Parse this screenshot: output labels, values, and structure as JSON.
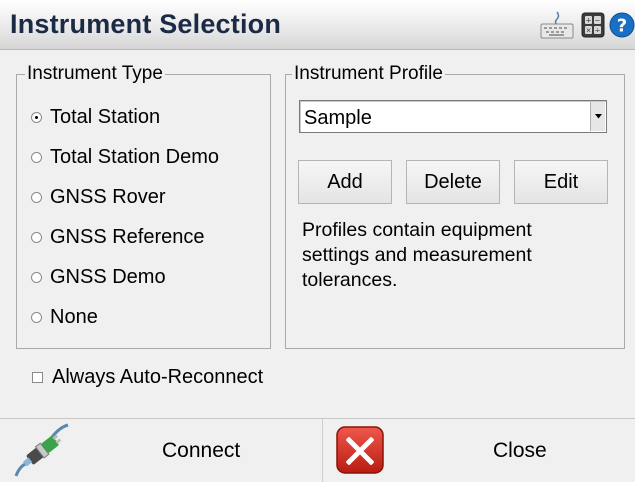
{
  "window": {
    "title": "Instrument Selection"
  },
  "toolbar_icons": [
    "keyboard-icon",
    "calculator-icon",
    "help-icon"
  ],
  "instrument_type": {
    "legend": "Instrument Type",
    "selected": "Total Station",
    "options": [
      {
        "label": "Total Station",
        "checked": true
      },
      {
        "label": "Total Station Demo",
        "checked": false
      },
      {
        "label": "GNSS Rover",
        "checked": false
      },
      {
        "label": "GNSS Reference",
        "checked": false
      },
      {
        "label": "GNSS Demo",
        "checked": false
      },
      {
        "label": "None",
        "checked": false
      }
    ]
  },
  "instrument_profile": {
    "legend": "Instrument Profile",
    "selected_profile": "Sample",
    "buttons": {
      "add": "Add",
      "delete": "Delete",
      "edit": "Edit"
    },
    "description": "Profiles contain equipment settings and measurement tolerances."
  },
  "auto_reconnect": {
    "label": "Always Auto-Reconnect",
    "checked": false
  },
  "bottom_bar": {
    "connect_label": "Connect",
    "close_label": "Close"
  },
  "colors": {
    "title_text": "#1b2a45",
    "close_icon_red": "#d42a1e",
    "help_blue": "#1a6fc4"
  }
}
